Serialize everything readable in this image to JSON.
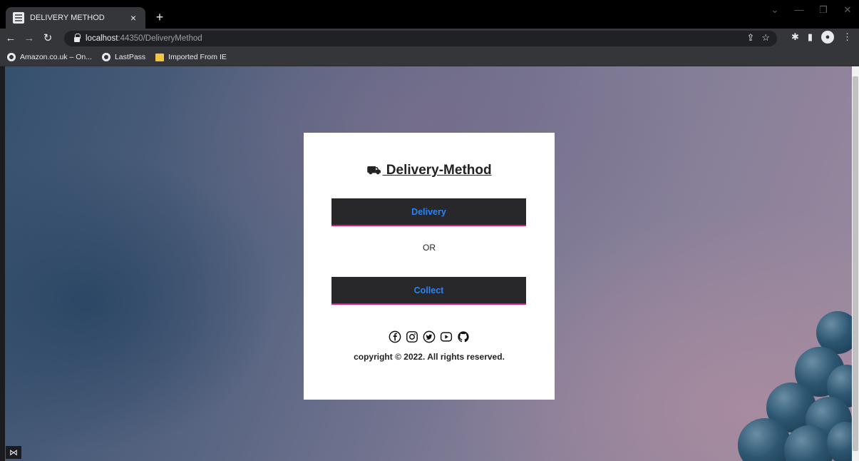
{
  "browser": {
    "tab_title": "DELIVERY METHOD",
    "tab_close": "×",
    "new_tab": "+",
    "url_host": "localhost",
    "url_rest": ":44350/DeliveryMethod",
    "bookmarks": [
      {
        "label": "Amazon.co.uk – On...",
        "icon": "globe-icon"
      },
      {
        "label": "LastPass",
        "icon": "globe-icon"
      },
      {
        "label": "Imported From IE",
        "icon": "folder-icon"
      }
    ]
  },
  "card": {
    "title_icon": "truck-icon",
    "title": " Delivery-Method",
    "delivery_label": "Delivery",
    "or_label": "OR",
    "collect_label": "Collect",
    "socials": [
      "facebook-icon",
      "instagram-icon",
      "twitter-icon",
      "youtube-icon",
      "github-icon"
    ],
    "copyright": "copyright © 2022. All rights reserved."
  },
  "colors": {
    "button_bg": "#28282b",
    "button_text": "#2a84f5",
    "button_accent": "#e0147c"
  }
}
